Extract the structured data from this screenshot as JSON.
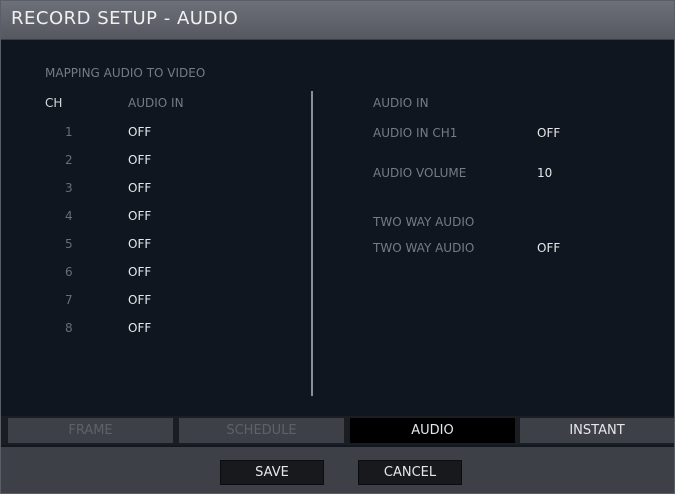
{
  "window": {
    "title": "RECORD SETUP - AUDIO"
  },
  "mapping": {
    "section_title": "MAPPING AUDIO TO VIDEO",
    "col_ch": "CH",
    "col_audio_in": "AUDIO IN",
    "rows": [
      {
        "ch": "1",
        "value": "OFF"
      },
      {
        "ch": "2",
        "value": "OFF"
      },
      {
        "ch": "3",
        "value": "OFF"
      },
      {
        "ch": "4",
        "value": "OFF"
      },
      {
        "ch": "5",
        "value": "OFF"
      },
      {
        "ch": "6",
        "value": "OFF"
      },
      {
        "ch": "7",
        "value": "OFF"
      },
      {
        "ch": "8",
        "value": "OFF"
      }
    ]
  },
  "audio_in": {
    "heading": "AUDIO IN",
    "ch1_label": "AUDIO IN CH1",
    "ch1_value": "OFF",
    "volume_label": "AUDIO VOLUME",
    "volume_value": "10"
  },
  "two_way": {
    "heading": "TWO WAY AUDIO",
    "label": "TWO WAY AUDIO",
    "value": "OFF"
  },
  "tabs": [
    {
      "label": "FRAME"
    },
    {
      "label": "SCHEDULE"
    },
    {
      "label": "AUDIO"
    },
    {
      "label": "INSTANT"
    }
  ],
  "buttons": {
    "save": "SAVE",
    "cancel": "CANCEL"
  }
}
